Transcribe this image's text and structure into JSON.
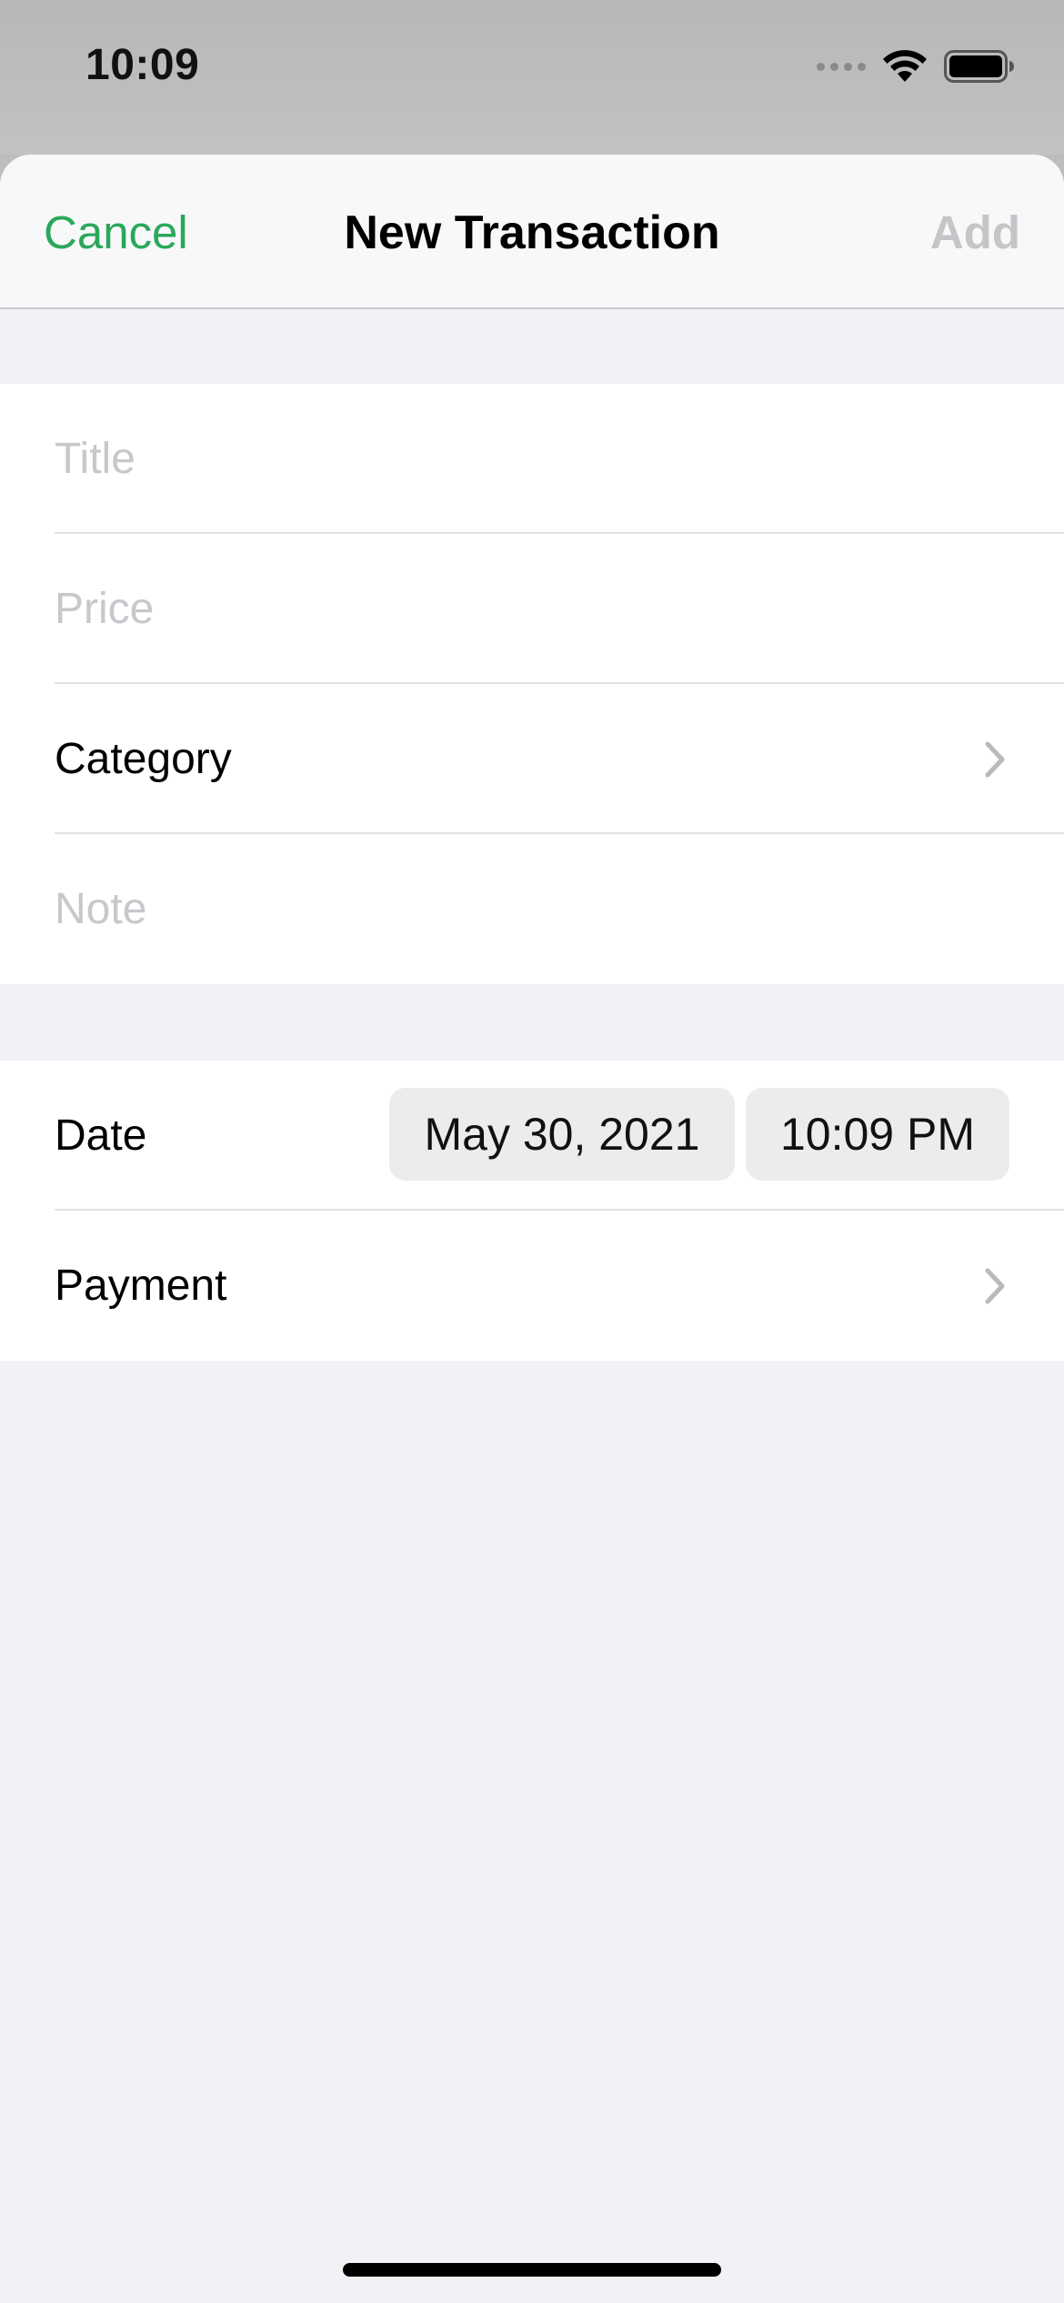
{
  "status_bar": {
    "time": "10:09",
    "icons": [
      "cellular-signal-icon",
      "wifi-icon",
      "battery-icon"
    ]
  },
  "navbar": {
    "cancel_label": "Cancel",
    "title": "New Transaction",
    "add_label": "Add"
  },
  "form": {
    "title": {
      "placeholder": "Title",
      "value": ""
    },
    "price": {
      "placeholder": "Price",
      "value": ""
    },
    "category_label": "Category",
    "note": {
      "placeholder": "Note",
      "value": ""
    },
    "date_label": "Date",
    "date_value": "May 30, 2021",
    "time_value": "10:09 PM",
    "payment_label": "Payment"
  },
  "colors": {
    "accent": "#2aa85a",
    "disabled": "#c5c5c8",
    "placeholder": "#c7c7cc",
    "background": "#f1f1f6"
  }
}
